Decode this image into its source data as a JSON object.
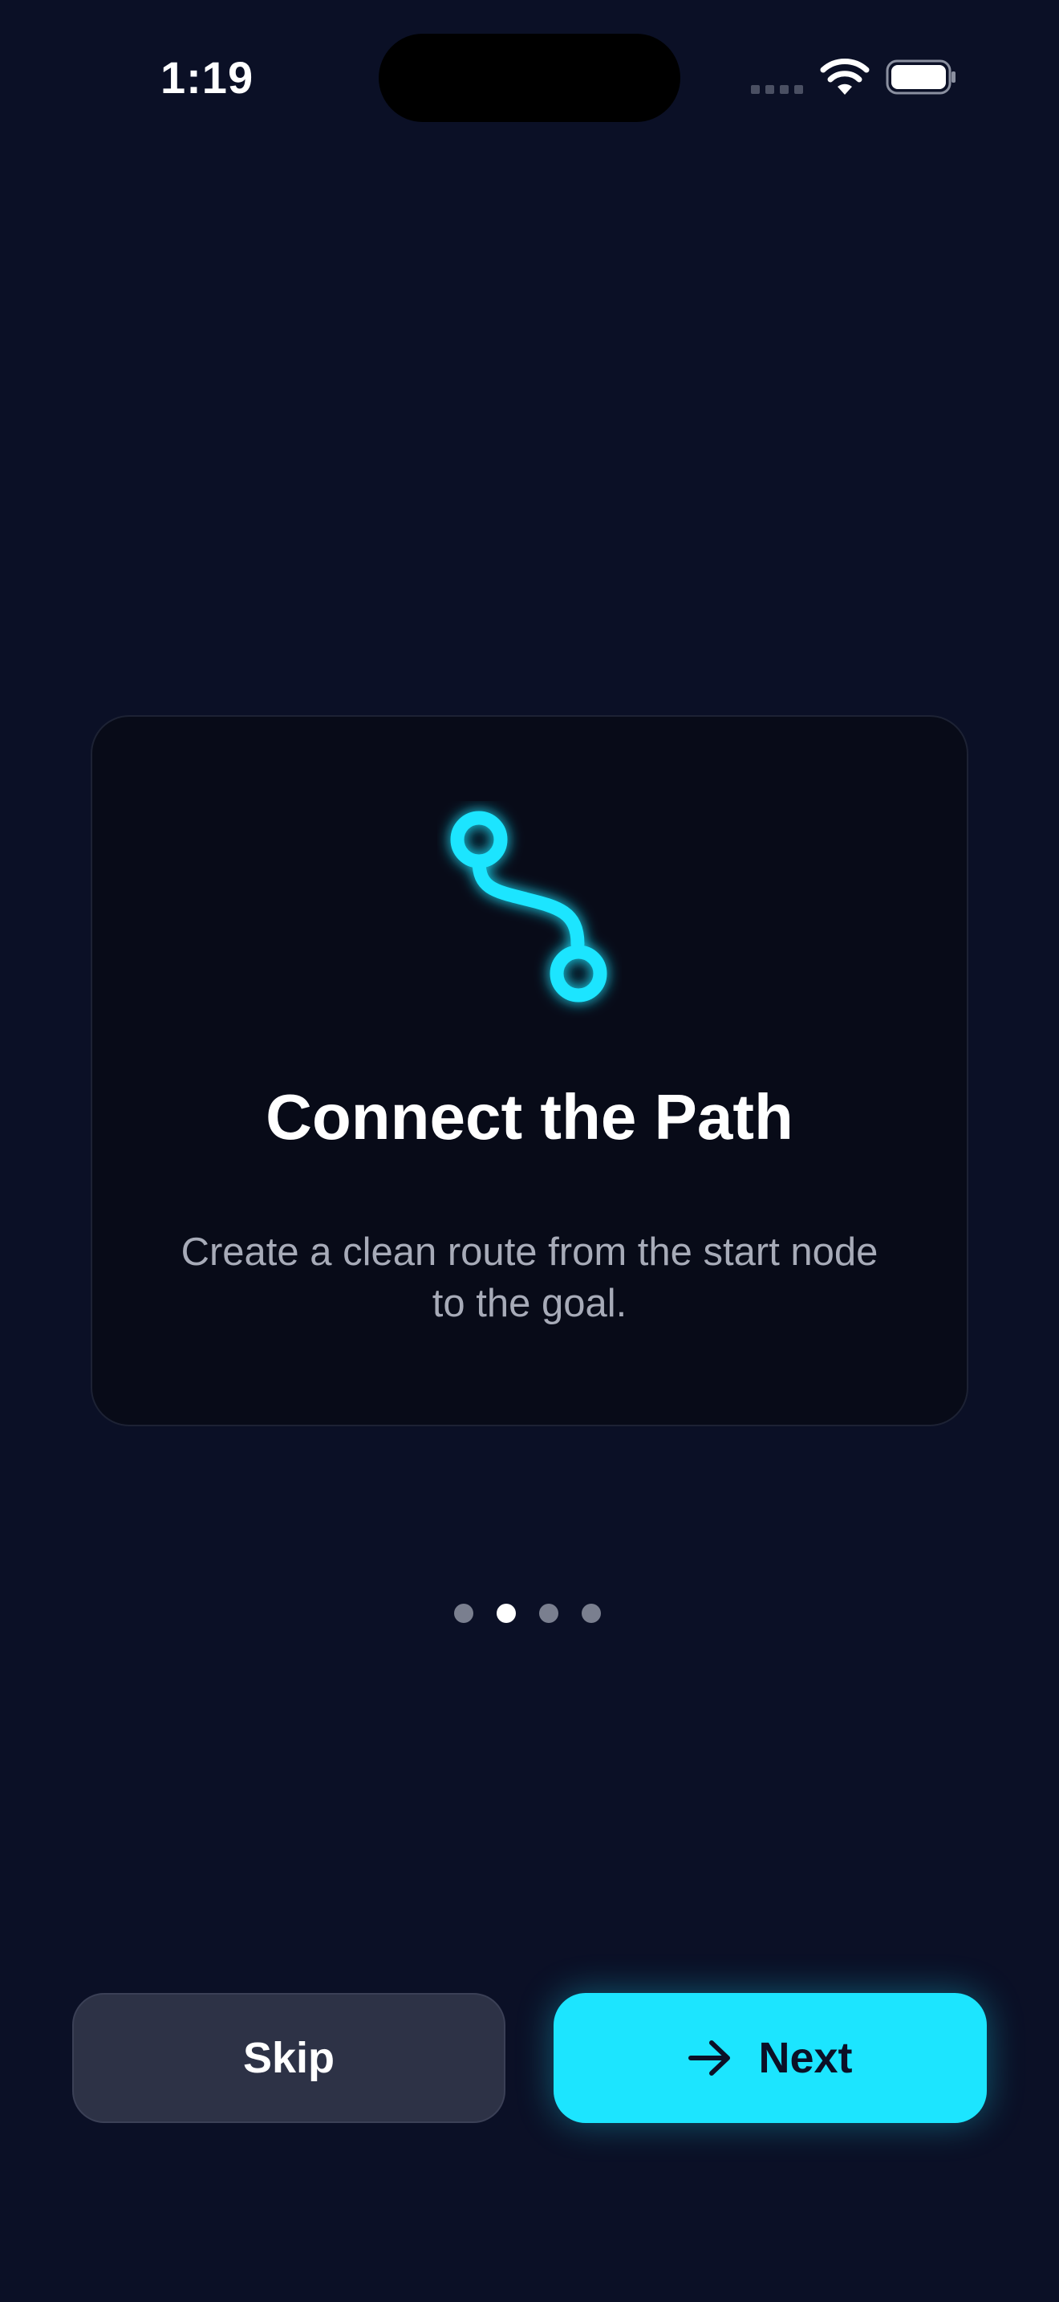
{
  "status_bar": {
    "time": "1:19"
  },
  "onboarding": {
    "title": "Connect the Path",
    "description": "Create a clean route from the start node to the goal.",
    "icon": "path-route-icon",
    "page_count": 4,
    "current_page": 2
  },
  "actions": {
    "skip_label": "Skip",
    "next_label": "Next"
  },
  "colors": {
    "background": "#0b1026",
    "card": "#080b18",
    "accent": "#1ce5ff",
    "skip_button": "#2d3246",
    "description_text": "#a7abb8"
  }
}
